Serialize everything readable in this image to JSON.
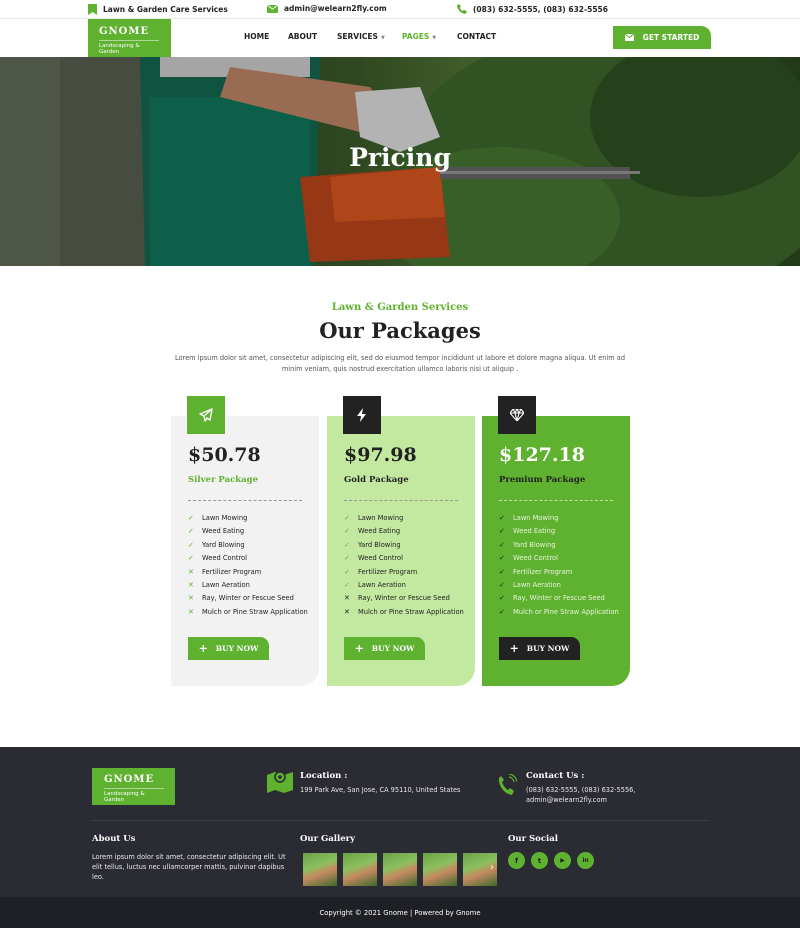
{
  "topbar": {
    "services": "Lawn & Garden Care Services",
    "email": "admin@welearn2fly.com",
    "phones": "(083) 632-5555, (083) 632-5556"
  },
  "brand": {
    "name": "GNOME",
    "tagline": "Landscaping & Garden"
  },
  "nav": {
    "home": "HOME",
    "about": "ABOUT",
    "services": "SERVICES",
    "pages": "PAGES",
    "contact": "CONTACT",
    "cta": "GET STARTED"
  },
  "hero": {
    "title": "Pricing"
  },
  "section": {
    "kicker": "Lawn & Garden Services",
    "title": "Our Packages",
    "desc": "Lorem ipsum dolor sit amet, consectetur adipiscing elit, sed do eiusmod tempor incididunt ut labore et dolore magna aliqua. Ut enim ad minim veniam, quis nostrud exercitation ullamco laboris nisi ut aliquip ."
  },
  "packages": [
    {
      "price": "$50.78",
      "name": "Silver Package",
      "button": "BUY NOW",
      "features": [
        {
          "label": "Lawn Mowing",
          "mark": "✓"
        },
        {
          "label": "Weed Eating",
          "mark": "✓"
        },
        {
          "label": "Yard Blowing",
          "mark": "✓"
        },
        {
          "label": "Weed Control",
          "mark": "✓"
        },
        {
          "label": "Fertilizer Program",
          "mark": "✕"
        },
        {
          "label": "Lawn Aeration",
          "mark": "✕"
        },
        {
          "label": "Ray, Winter or Fescue Seed",
          "mark": "✕"
        },
        {
          "label": "Mulch or Pine Straw Application",
          "mark": "✕"
        }
      ]
    },
    {
      "price": "$97.98",
      "name": "Gold Package",
      "button": "BUY NOW",
      "features": [
        {
          "label": "Lawn Mowing",
          "mark": "✓"
        },
        {
          "label": "Weed Eating",
          "mark": "✓"
        },
        {
          "label": "Yard Blowing",
          "mark": "✓"
        },
        {
          "label": "Weed Control",
          "mark": "✓"
        },
        {
          "label": "Fertilizer Program",
          "mark": "✓"
        },
        {
          "label": "Lawn Aeration",
          "mark": "✓"
        },
        {
          "label": "Ray, Winter or Fescue Seed",
          "mark": "✕"
        },
        {
          "label": "Mulch or Pine Straw Application",
          "mark": "✕"
        }
      ]
    },
    {
      "price": "$127.18",
      "name": "Premium Package",
      "button": "BUY NOW",
      "features": [
        {
          "label": "Lawn Mowing",
          "mark": "✓"
        },
        {
          "label": "Weed Eating",
          "mark": "✓"
        },
        {
          "label": "Yard Blowing",
          "mark": "✓"
        },
        {
          "label": "Weed Control",
          "mark": "✓"
        },
        {
          "label": "Fertilizer Program",
          "mark": "✓"
        },
        {
          "label": "Lawn Aeration",
          "mark": "✓"
        },
        {
          "label": "Ray, Winter or Fescue Seed",
          "mark": "✓"
        },
        {
          "label": "Mulch or Pine Straw Application",
          "mark": "✓"
        }
      ]
    }
  ],
  "footer": {
    "location_title": "Location :",
    "location_text": "199 Park Ave, San Jose, CA 95110, United States",
    "contact_title": "Contact Us :",
    "contact_phones": "(083) 632-5555, (083) 632-5556,",
    "contact_email": "admin@welearn2fly.com",
    "about_title": "About Us",
    "about_text": "Lorem ipsum dolor sit amet, consectetur adipiscing elit. Ut elit tellus, luctus nec ullamcorper mattis, pulvinar dapibus leo.",
    "gallery_title": "Our Gallery",
    "social_title": "Our Social",
    "social": [
      "f",
      "t",
      "▶",
      "in"
    ],
    "copyright": "Copyright © 2021 Gnome | Powered by Gnome"
  },
  "colors": {
    "accent": "#5fb130",
    "light_accent": "#c3e9a0",
    "dark": "#222222",
    "footer": "#2a2b33"
  },
  "icons": {
    "topbar": [
      "bookmark-icon",
      "envelope-icon",
      "phone-icon"
    ],
    "packages": [
      "paper-plane-icon",
      "bolt-icon",
      "diamond-icon"
    ],
    "footer": [
      "map-icon",
      "phone-ring-icon"
    ]
  }
}
